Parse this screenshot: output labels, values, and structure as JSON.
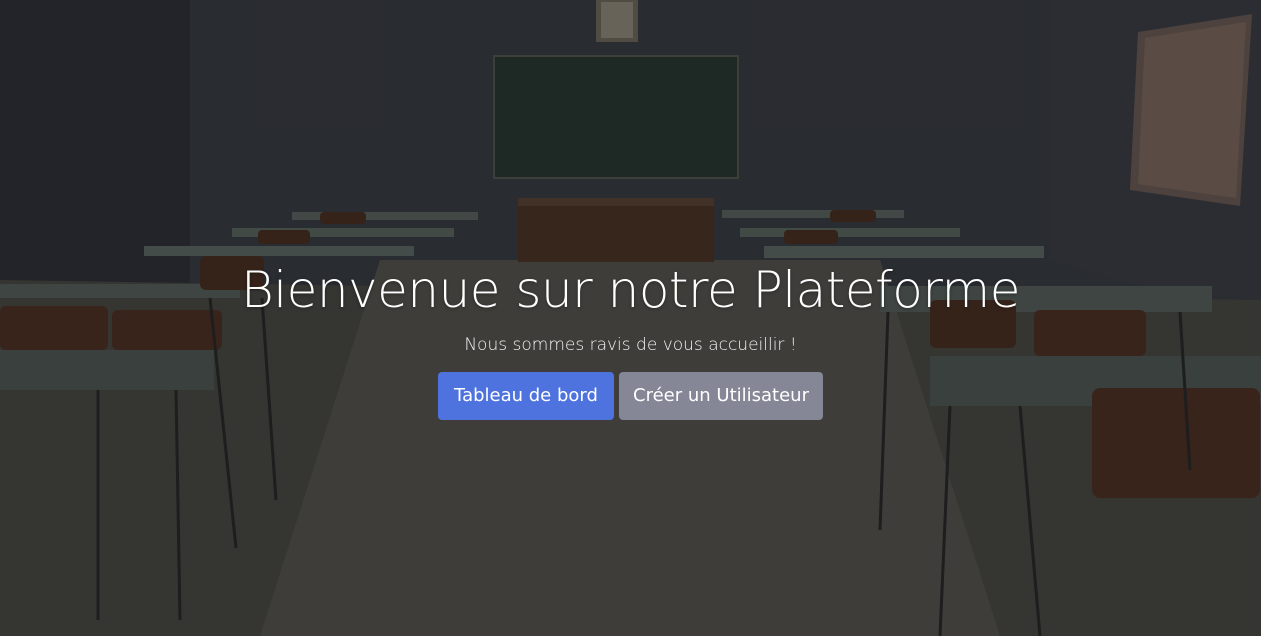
{
  "hero": {
    "title": "Bienvenue sur notre Plateforme",
    "subtitle": "Nous sommes ravis de vous accueillir !",
    "background_image": "classroom-photo"
  },
  "actions": {
    "dashboard_label": "Tableau de bord",
    "create_user_label": "Créer un Utilisateur"
  },
  "colors": {
    "primary": "#4e73df",
    "secondary": "#858796"
  }
}
